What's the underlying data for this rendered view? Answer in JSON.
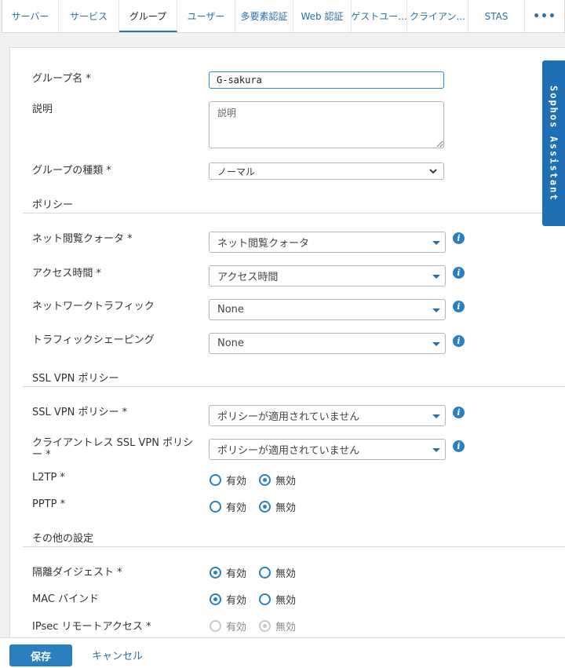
{
  "tabs": [
    {
      "label": "サーバー",
      "active": false
    },
    {
      "label": "サービス",
      "active": false
    },
    {
      "label": "グループ",
      "active": true
    },
    {
      "label": "ユーザー",
      "active": false
    },
    {
      "label": "多要素認証",
      "active": false
    },
    {
      "label": "Web 認証",
      "active": false
    },
    {
      "label": "ゲストユー...",
      "active": false
    },
    {
      "label": "クライアン...",
      "active": false
    },
    {
      "label": "STAS",
      "active": false
    },
    {
      "label": "•••",
      "active": false
    }
  ],
  "assistant": {
    "label": "Sophos Assistant"
  },
  "form": {
    "group_name": {
      "label": "グループ名 *",
      "value": "G-sakura"
    },
    "description": {
      "label": "説明",
      "placeholder": "説明"
    },
    "group_type": {
      "label": "グループの種類 *",
      "value": "ノーマル"
    },
    "policy_section": "ポリシー",
    "web_quota": {
      "label": "ネット閲覧クォータ *",
      "value": "ネット閲覧クォータ"
    },
    "access_time": {
      "label": "アクセス時間 *",
      "value": "アクセス時間"
    },
    "network_traffic": {
      "label": "ネットワークトラフィック",
      "value": "None"
    },
    "traffic_shaping": {
      "label": "トラフィックシェーピング",
      "value": "None"
    },
    "ssl_section": "SSL VPN ポリシー",
    "ssl_vpn_policy": {
      "label": "SSL VPN ポリシー *",
      "value": "ポリシーが適用されていません"
    },
    "clientless_ssl": {
      "label": "クライアントレス SSL VPN ポリシー *",
      "value": "ポリシーが適用されていません"
    },
    "l2tp": {
      "label": "L2TP *",
      "on": "有効",
      "off": "無効",
      "selected": "off"
    },
    "pptp": {
      "label": "PPTP *",
      "on": "有効",
      "off": "無効",
      "selected": "off"
    },
    "other_section": "その他の設定",
    "quarantine_digest": {
      "label": "隔離ダイジェスト *",
      "on": "有効",
      "off": "無効",
      "selected": "on"
    },
    "mac_binding": {
      "label": "MAC バインド",
      "on": "有効",
      "off": "無効",
      "selected": "on"
    },
    "ipsec_remote": {
      "label": "IPsec リモートアクセス *",
      "on": "有効",
      "off": "無効",
      "selected": "off",
      "disabled": true
    }
  },
  "footer": {
    "save": "保存",
    "cancel": "キャンセル"
  },
  "colors": {
    "accent": "#2a7fc0",
    "assistant": "#1f6fb5"
  }
}
